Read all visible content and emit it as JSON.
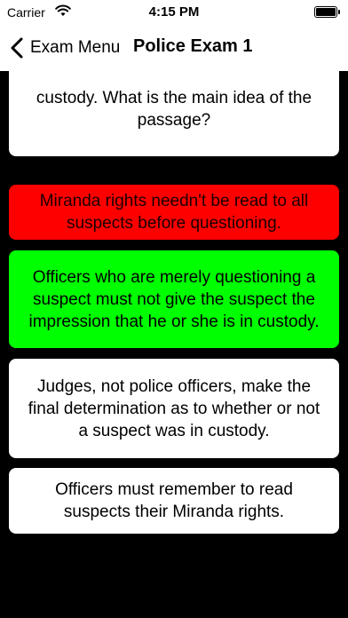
{
  "status_bar": {
    "carrier": "Carrier",
    "time": "4:15 PM",
    "wifi_icon": "wifi-icon",
    "battery_icon": "battery-icon"
  },
  "nav": {
    "back_label": "Exam Menu",
    "title": "Police Exam 1",
    "back_icon": "chevron-left-icon"
  },
  "question": {
    "text": "custody. What is the main idea of the passage?"
  },
  "answers": [
    {
      "text": "Miranda rights needn't be read to all suspects before questioning.",
      "state": "incorrect",
      "color": "#ff0000"
    },
    {
      "text": "Officers who are merely questioning a suspect must not give the suspect the impression that he or she is in custody.",
      "state": "correct",
      "color": "#00ff00"
    },
    {
      "text": "Judges, not police officers, make the final determination as to whether or not a suspect was in custody.",
      "state": "neutral",
      "color": "#ffffff"
    },
    {
      "text": "Officers must remember to read suspects their Miranda rights.",
      "state": "neutral",
      "color": "#ffffff"
    }
  ]
}
